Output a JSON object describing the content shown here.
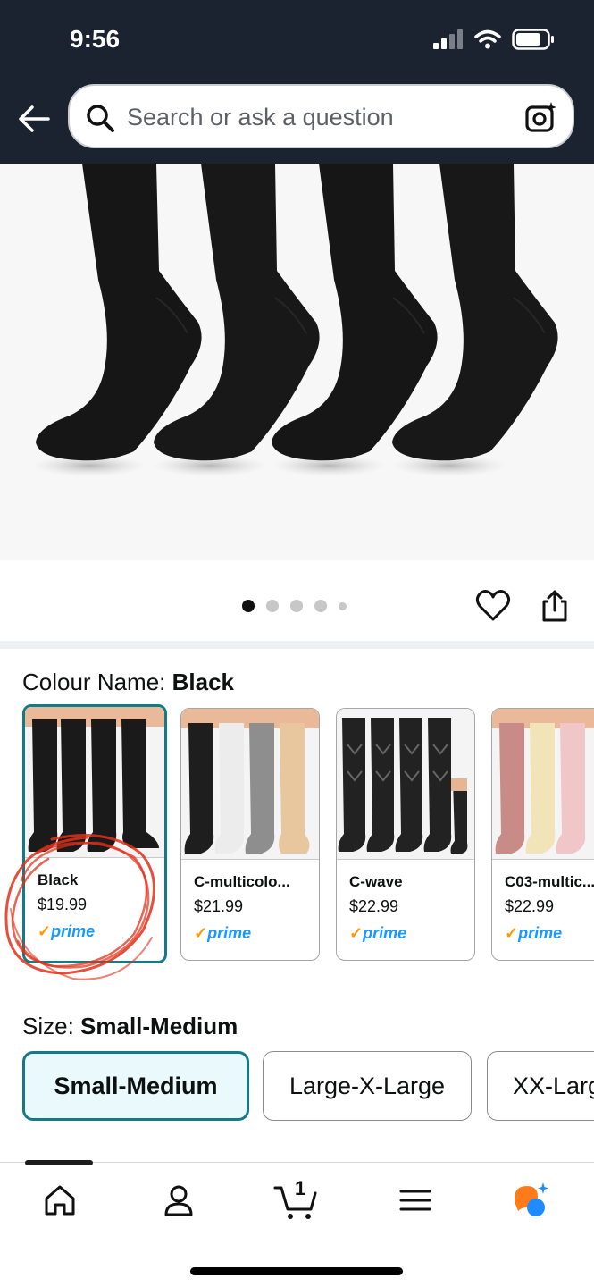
{
  "status_bar": {
    "time": "9:56"
  },
  "search": {
    "placeholder": "Search or ask a question"
  },
  "product_image": {
    "pagination": {
      "count": 5,
      "active_index": 0
    }
  },
  "colour": {
    "label": "Colour Name: ",
    "selected": "Black",
    "options": [
      {
        "name": "Black",
        "price": "$19.99",
        "prime": "prime"
      },
      {
        "name": "C-multicolo...",
        "price": "$21.99",
        "prime": "prime"
      },
      {
        "name": "C-wave",
        "price": "$22.99",
        "prime": "prime"
      },
      {
        "name": "C03-multic...",
        "price": "$22.99",
        "prime": "prime"
      }
    ]
  },
  "size": {
    "label": "Size: ",
    "selected": "Small-Medium",
    "options": [
      "Small-Medium",
      "Large-X-Large",
      "XX-Large"
    ]
  },
  "tabbar": {
    "cart_count": "1",
    "tabs": [
      "home-icon",
      "account-icon",
      "cart-icon",
      "menu-icon",
      "rufus-assistant-icon"
    ]
  },
  "colors": {
    "header_bg": "#1b2330",
    "accent_teal": "#137b87",
    "prime_blue": "#1a98ff",
    "annotation_red": "#e0311a"
  }
}
